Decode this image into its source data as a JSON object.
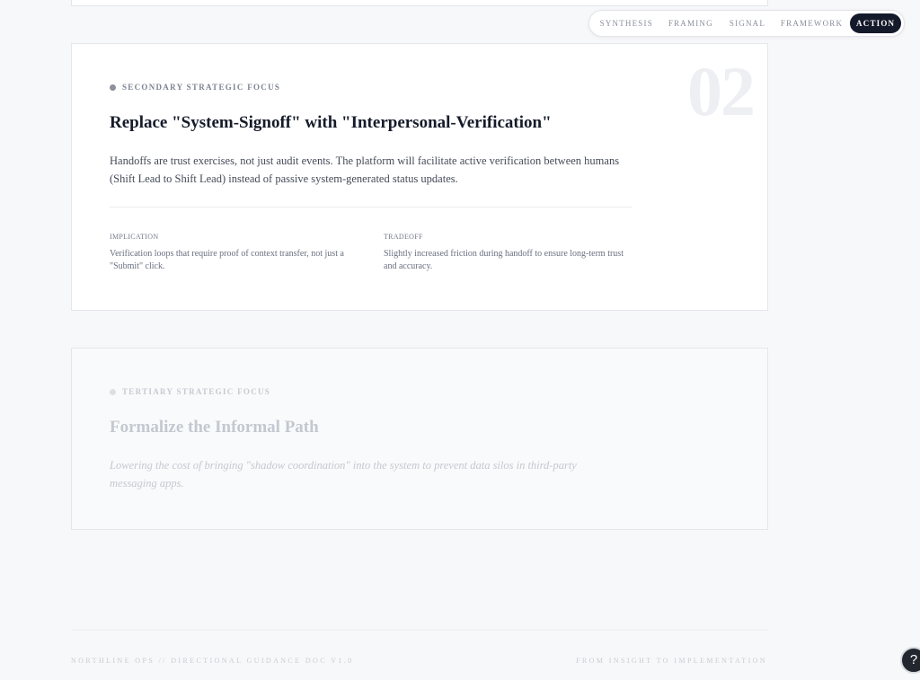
{
  "nav": {
    "items": [
      "SYNTHESIS",
      "FRAMING",
      "SIGNAL",
      "FRAMEWORK",
      "ACTION"
    ],
    "active": "ACTION"
  },
  "card_secondary": {
    "eyebrow": "SECONDARY STRATEGIC FOCUS",
    "number": "02",
    "title": "Replace \"System-Signoff\" with \"Interpersonal-Verification\"",
    "body": "Handoffs are trust exercises, not just audit events. The platform will facilitate active verification between humans (Shift Lead to Shift Lead) instead of passive system-generated status updates.",
    "implication_label": "IMPLICATION",
    "implication_text": "Verification loops that require proof of context transfer, not just a \"Submit\" click.",
    "tradeoff_label": "TRADEOFF",
    "tradeoff_text": "Slightly increased friction during handoff to ensure long-term trust and accuracy."
  },
  "card_tertiary": {
    "eyebrow": "TERTIARY STRATEGIC FOCUS",
    "title": "Formalize the Informal Path",
    "body": "Lowering the cost of bringing \"shadow coordination\" into the system to prevent data silos in third-party messaging apps."
  },
  "footer": {
    "left": "NORTHLINE OPS // DIRECTIONAL GUIDANCE DOC V1.0",
    "right": "FROM INSIGHT TO IMPLEMENTATION"
  },
  "help": {
    "label": "?"
  }
}
